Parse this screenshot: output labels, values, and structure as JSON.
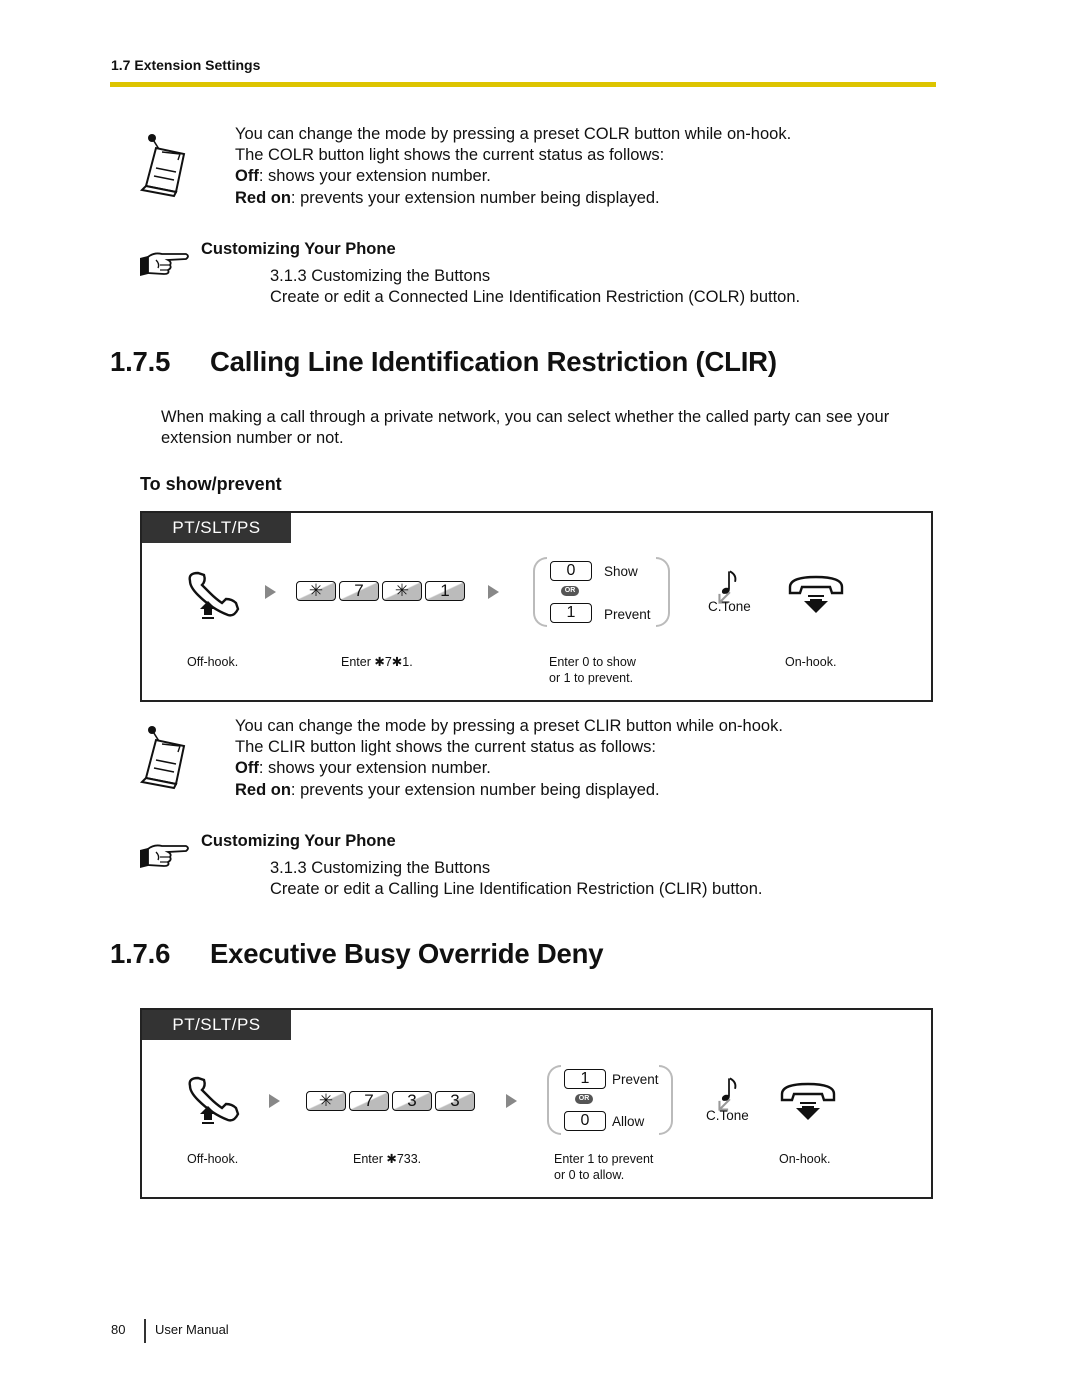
{
  "header": {
    "running_head": "1.7 Extension Settings",
    "rule_color": "#ddc400"
  },
  "colr_note": {
    "icon": "note-icon",
    "line1": "You can change the mode by pressing a preset COLR button while on-hook.",
    "line2": "The COLR button light shows the current status as follows:",
    "off_label": "Off",
    "off_text": ": shows your extension number.",
    "red_label": "Red on",
    "red_text": ": prevents your extension number being displayed."
  },
  "colr_ref": {
    "icon": "pointing-hand-icon",
    "title": "Customizing Your Phone",
    "line1": "3.1.3 Customizing the Buttons",
    "line2": "Create or edit a Connected Line Identification Restriction (COLR) button."
  },
  "section_175": {
    "number": "1.7.5",
    "title": "Calling Line Identification Restriction (CLIR)",
    "intro_line1": "When making a call through a private network, you can select whether the called party can see your",
    "intro_line2": "extension number or not.",
    "subheading": "To show/prevent",
    "procedure": {
      "tab": "PT/SLT/PS",
      "keys": [
        "✳",
        "7",
        "✳",
        "1"
      ],
      "options": [
        {
          "key": "0",
          "label": "Show"
        },
        {
          "key": "1",
          "label": "Prevent"
        }
      ],
      "or_label": "OR",
      "tone_label": "C.Tone",
      "captions": {
        "off_hook": "Off-hook.",
        "enter": "Enter ✱7✱1.",
        "choice_line1": "Enter 0 to show",
        "choice_line2": "or 1 to prevent.",
        "on_hook": "On-hook."
      }
    }
  },
  "clir_note": {
    "icon": "note-icon",
    "line1": "You can change the mode by pressing a preset CLIR button while on-hook.",
    "line2": "The CLIR button light shows the current status as follows:",
    "off_label": "Off",
    "off_text": ": shows your extension number.",
    "red_label": "Red on",
    "red_text": ": prevents your extension number being displayed."
  },
  "clir_ref": {
    "icon": "pointing-hand-icon",
    "title": "Customizing Your Phone",
    "line1": "3.1.3 Customizing the Buttons",
    "line2": "Create or edit a Calling Line Identification Restriction (CLIR) button."
  },
  "section_176": {
    "number": "1.7.6",
    "title": "Executive Busy Override Deny",
    "procedure": {
      "tab": "PT/SLT/PS",
      "keys": [
        "✳",
        "7",
        "3",
        "3"
      ],
      "options": [
        {
          "key": "1",
          "label": "Prevent"
        },
        {
          "key": "0",
          "label": "Allow"
        }
      ],
      "or_label": "OR",
      "tone_label": "C.Tone",
      "captions": {
        "off_hook": "Off-hook.",
        "enter": "Enter ✱733.",
        "choice_line1": "Enter 1 to prevent",
        "choice_line2": "or 0 to allow.",
        "on_hook": "On-hook."
      }
    }
  },
  "footer": {
    "page_number": "80",
    "label": "User Manual"
  }
}
